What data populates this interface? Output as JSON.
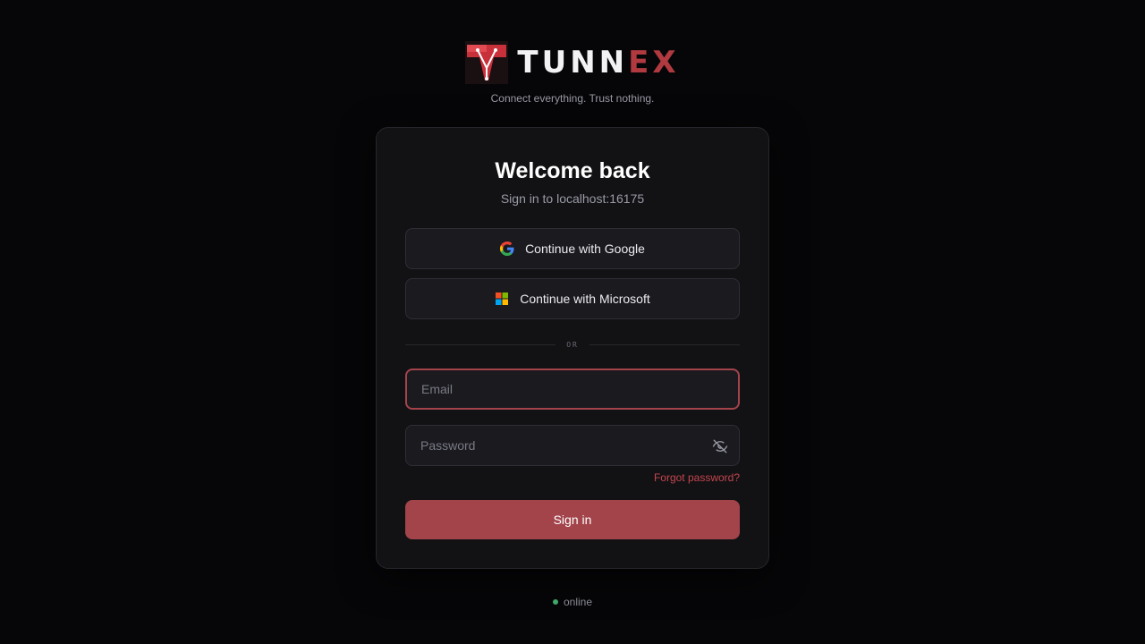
{
  "brand": {
    "name_main": "TUNN",
    "name_accent": "EX",
    "tagline": "Connect everything. Trust nothing.",
    "logo_icon": "tunnex-logo-icon",
    "accent_color": "#b03a40"
  },
  "card": {
    "title": "Welcome back",
    "subtitle": "Sign in to localhost:16175"
  },
  "oauth": {
    "google_label": "Continue with Google",
    "google_icon": "google-icon",
    "microsoft_label": "Continue with Microsoft",
    "microsoft_icon": "microsoft-icon"
  },
  "divider": {
    "label": "OR"
  },
  "form": {
    "email_placeholder": "Email",
    "email_value": "",
    "password_placeholder": "Password",
    "password_value": "",
    "password_toggle_icon": "eye-off-icon",
    "forgot_label": "Forgot password?",
    "submit_label": "Sign in",
    "submit_color": "#a3444b"
  },
  "status": {
    "label": "online",
    "color": "#3fa86a"
  }
}
